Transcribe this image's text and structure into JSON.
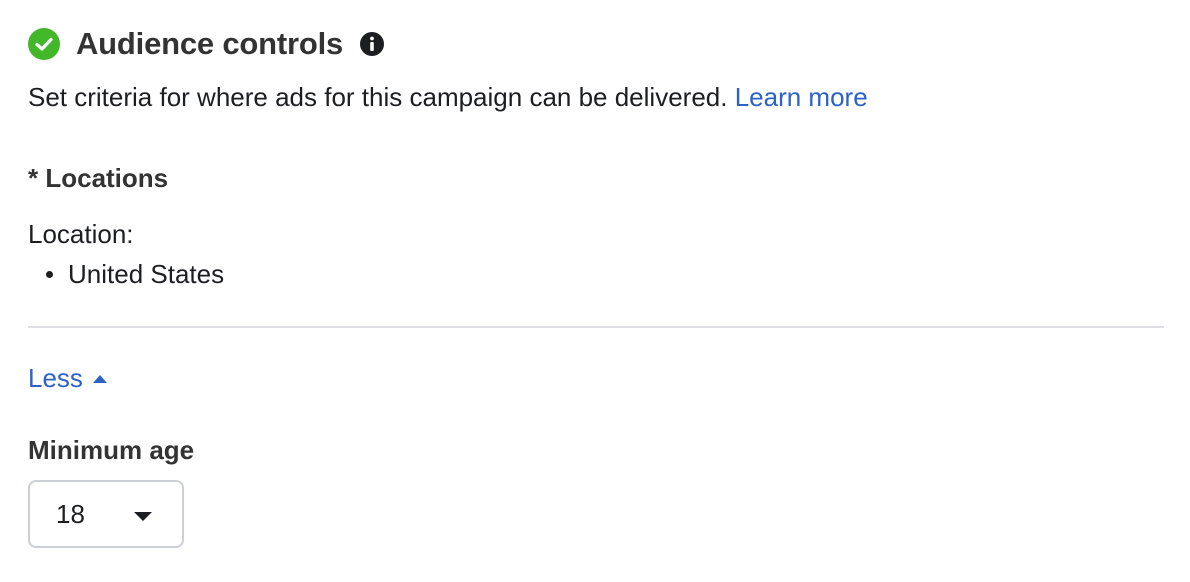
{
  "header": {
    "title": "Audience controls",
    "status_icon": "check-circle-icon",
    "status_color": "#42b72a",
    "info_icon": "info-icon"
  },
  "description": {
    "text": "Set criteria for where ads for this campaign can be delivered.",
    "link_label": "Learn more"
  },
  "locations": {
    "section_label": "* Locations",
    "location_label": "Location:",
    "items": [
      "United States"
    ]
  },
  "toggle": {
    "label": "Less",
    "icon": "caret-up-icon"
  },
  "minimum_age": {
    "label": "Minimum age",
    "selected_value": "18",
    "icon": "caret-down-icon"
  },
  "colors": {
    "link": "#2d62c8",
    "text": "#1c1e21",
    "heading": "#333333",
    "divider": "#dddfe2",
    "success": "#42b72a"
  }
}
